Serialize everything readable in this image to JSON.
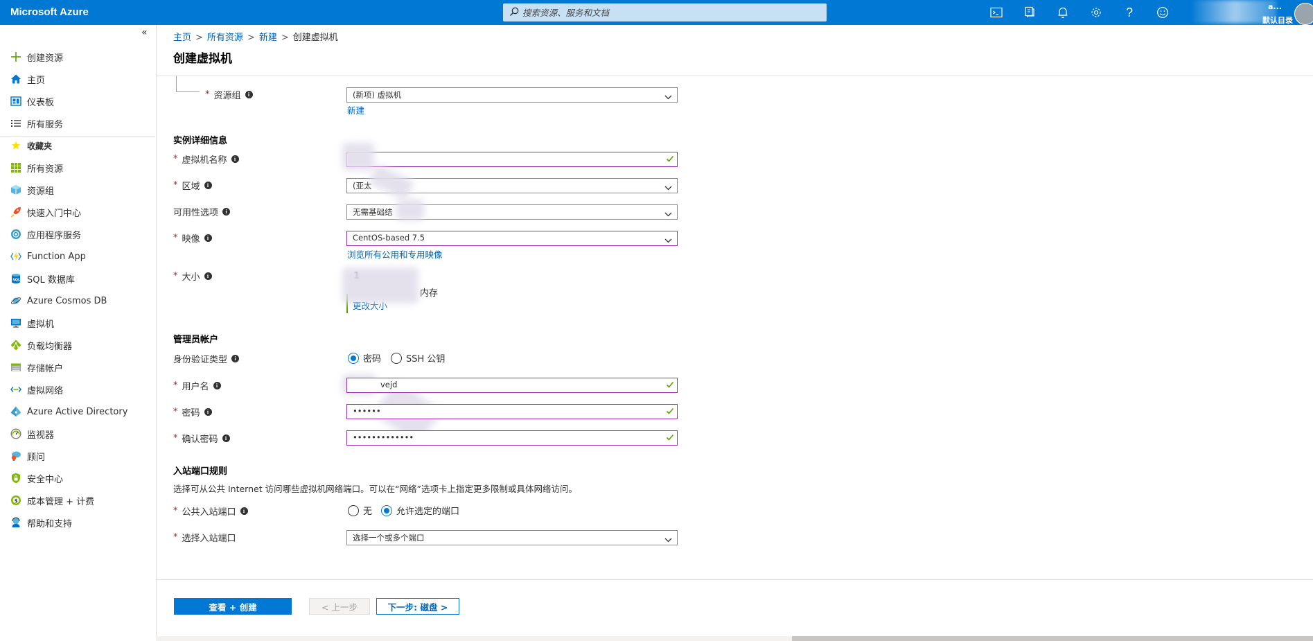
{
  "app": {
    "brand": "Microsoft Azure"
  },
  "search": {
    "placeholder": "搜索资源、服务和文档"
  },
  "topbar": {
    "icons": [
      "cloud-shell-icon",
      "directory-filter-icon",
      "notifications-icon",
      "settings-icon",
      "help-icon",
      "feedback-icon"
    ],
    "help_glyph": "?",
    "account_line1": "a...",
    "account_line2": "默认目录"
  },
  "sidebar": {
    "collapse_glyph": "«",
    "items": [
      {
        "label": "创建资源",
        "icon": "plus-icon"
      },
      {
        "label": "主页",
        "icon": "home-icon"
      },
      {
        "label": "仪表板",
        "icon": "dashboard-icon"
      },
      {
        "label": "所有服务",
        "icon": "list-icon"
      },
      {
        "label": "收藏夹",
        "icon": "star-icon"
      },
      {
        "label": "所有资源",
        "icon": "grid-icon"
      },
      {
        "label": "资源组",
        "icon": "resource-group-icon"
      },
      {
        "label": "快速入门中心",
        "icon": "rocket-icon"
      },
      {
        "label": "应用程序服务",
        "icon": "app-service-icon"
      },
      {
        "label": "Function App",
        "icon": "function-icon"
      },
      {
        "label": "SQL 数据库",
        "icon": "sql-icon"
      },
      {
        "label": "Azure Cosmos DB",
        "icon": "cosmos-icon"
      },
      {
        "label": "虚拟机",
        "icon": "vm-icon"
      },
      {
        "label": "负载均衡器",
        "icon": "load-balancer-icon"
      },
      {
        "label": "存储帐户",
        "icon": "storage-icon"
      },
      {
        "label": "虚拟网络",
        "icon": "vnet-icon"
      },
      {
        "label": "Azure Active Directory",
        "icon": "aad-icon"
      },
      {
        "label": "监视器",
        "icon": "monitor-icon"
      },
      {
        "label": "顾问",
        "icon": "advisor-icon"
      },
      {
        "label": "安全中心",
        "icon": "security-icon"
      },
      {
        "label": "成本管理 + 计费",
        "icon": "cost-icon"
      },
      {
        "label": "帮助和支持",
        "icon": "support-icon"
      }
    ]
  },
  "breadcrumb": {
    "items": [
      "主页",
      "所有资源",
      "新建"
    ],
    "current": "创建虚拟机",
    "sep": ">"
  },
  "page": {
    "title": "创建虚拟机"
  },
  "form": {
    "resource_group": {
      "label": "资源组",
      "value": "(新项) 虚拟机",
      "new_link": "新建"
    },
    "instance_section": "实例详细信息",
    "vm_name": {
      "label": "虚拟机名称",
      "value": ""
    },
    "region": {
      "label": "区域",
      "value": "(亚太"
    },
    "availability": {
      "label": "可用性选项",
      "value": "无需基础结"
    },
    "image": {
      "label": "映像",
      "value": "CentOS-based 7.5",
      "browse_link": "浏览所有公用和专用映像"
    },
    "size": {
      "label": "大小",
      "value_line1": "1",
      "value_line2": "内存",
      "change_link": "更改大小"
    },
    "admin_section": "管理员帐户",
    "auth_type": {
      "label": "身份验证类型",
      "options": [
        "密码",
        "SSH 公钥"
      ],
      "selected": "密码"
    },
    "username": {
      "label": "用户名",
      "value": "vejd"
    },
    "password": {
      "label": "密码",
      "value": "••••••"
    },
    "confirm_password": {
      "label": "确认密码",
      "value": "•••••••••••••"
    },
    "inbound_section": "入站端口规则",
    "inbound_desc": "选择可从公共 Internet 访问哪些虚拟机网络端口。可以在“网络”选项卡上指定更多限制或具体网络访问。",
    "public_ports": {
      "label": "公共入站端口",
      "options": [
        "无",
        "允许选定的端口"
      ],
      "selected": "允许选定的端口"
    },
    "select_ports": {
      "label": "选择入站端口",
      "value": "选择一个或多个端口"
    }
  },
  "footer": {
    "review_create": "查看 + 创建",
    "previous": "< 上一步",
    "next": "下一步: 磁盘 >"
  },
  "colors": {
    "brand": "#0078d4",
    "highlight_border": "#9b2fae",
    "valid_check": "#57a300",
    "required": "#a4262c"
  }
}
